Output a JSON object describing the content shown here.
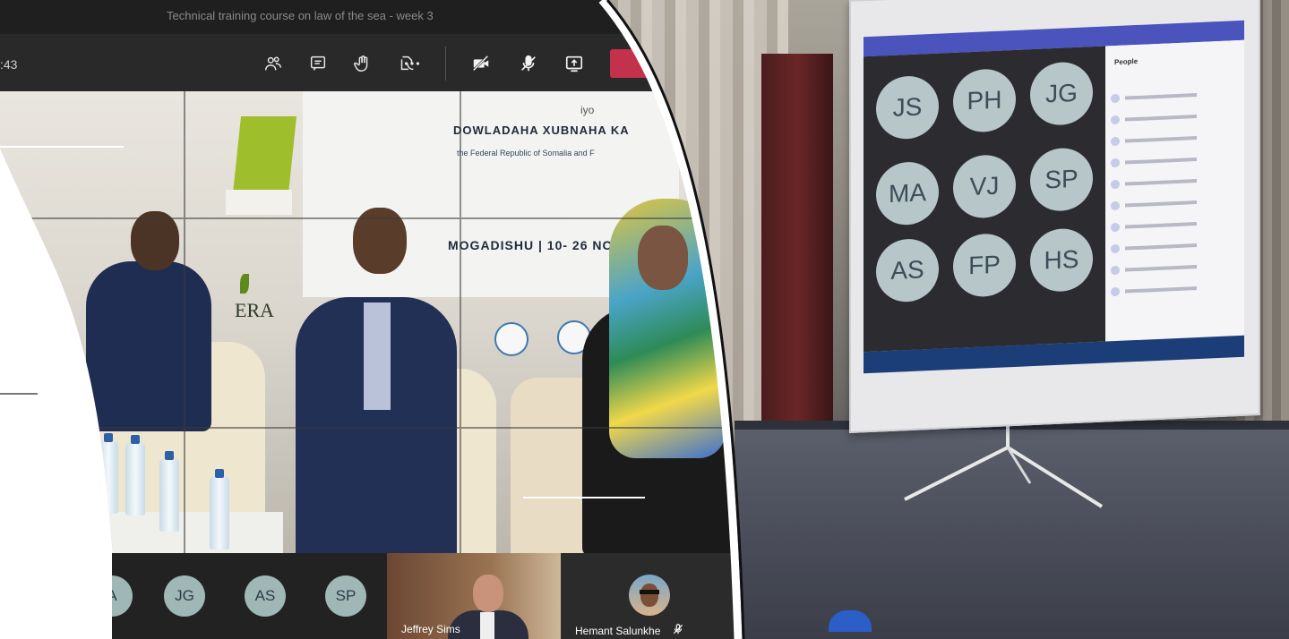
{
  "meeting": {
    "title": "Technical training course on law of the sea - week 3",
    "timer": ":43"
  },
  "toolbar": {
    "icons": [
      "participants-icon",
      "chat-icon",
      "raise-hand-icon",
      "reactions-icon",
      "more-options-icon",
      "camera-off-icon",
      "mic-off-icon",
      "share-screen-icon",
      "leave-button"
    ]
  },
  "stage": {
    "banner_small": "iyo",
    "banner_line1": "DOWLADAHA XUBNAHA KA",
    "banner_line2": "the Federal Republic of Somalia and F",
    "banner_line3": "MOGADISHU | 10- 26 NC",
    "banner_era": "ERA"
  },
  "participants": [
    {
      "initials": "A"
    },
    {
      "initials": "JG"
    },
    {
      "initials": "AS"
    },
    {
      "initials": "SP"
    }
  ],
  "video_tiles": {
    "jeffrey": {
      "name": "Jeffrey Sims"
    },
    "hemant": {
      "name": "Hemant Salunkhe",
      "mic": "🎙̸"
    }
  },
  "projected_screen": {
    "avatars": [
      "JS",
      "PH",
      "JG",
      "MA",
      "VJ",
      "SP",
      "AS",
      "FP",
      "HS"
    ],
    "people_title": "People"
  },
  "colors": {
    "teams_titlebar": "#1f1f1f",
    "teams_toolbar": "#292929",
    "leave_red": "#c4314b",
    "avatar_bg": "#9fb7b5"
  }
}
